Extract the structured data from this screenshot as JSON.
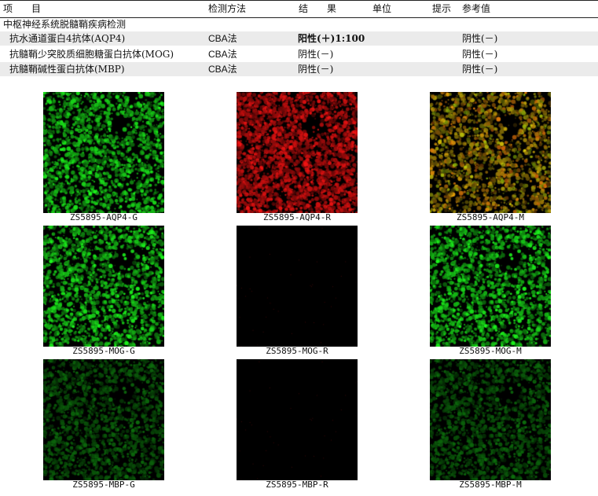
{
  "header": {
    "item": "项　　目",
    "method": "检测方法",
    "result": "结　　果",
    "unit": "单位",
    "hint": "提示",
    "reference": "参考值"
  },
  "section": {
    "title": "中枢神经系统脱髓鞘疾病检测"
  },
  "rows": [
    {
      "item": "抗水通道蛋白4抗体(AQP4)",
      "method": "CBA法",
      "result": "阳性(＋)1:100",
      "reference": "阴性(－)"
    },
    {
      "item": "抗髓鞘少突胶质细胞糖蛋白抗体(MOG)",
      "method": "CBA法",
      "result": "阴性(－)",
      "reference": "阴性(－)"
    },
    {
      "item": "抗髓鞘碱性蛋白抗体(MBP)",
      "method": "CBA法",
      "result": "阴性(－)",
      "reference": "阴性(－)"
    }
  ],
  "images": [
    {
      "caption": "ZS5895-AQP4-G",
      "channel": "green",
      "intensity": "bright"
    },
    {
      "caption": "ZS5895-AQP4-R",
      "channel": "red",
      "intensity": "bright"
    },
    {
      "caption": "ZS5895-AQP4-M",
      "channel": "merge",
      "intensity": "bright"
    },
    {
      "caption": "ZS5895-MOG-G",
      "channel": "green",
      "intensity": "bright"
    },
    {
      "caption": "ZS5895-MOG-R",
      "channel": "red",
      "intensity": "dark"
    },
    {
      "caption": "ZS5895-MOG-M",
      "channel": "green",
      "intensity": "bright"
    },
    {
      "caption": "ZS5895-MBP-G",
      "channel": "green",
      "intensity": "dim"
    },
    {
      "caption": "ZS5895-MBP-R",
      "channel": "red",
      "intensity": "dark"
    },
    {
      "caption": "ZS5895-MBP-M",
      "channel": "green",
      "intensity": "dim"
    }
  ]
}
